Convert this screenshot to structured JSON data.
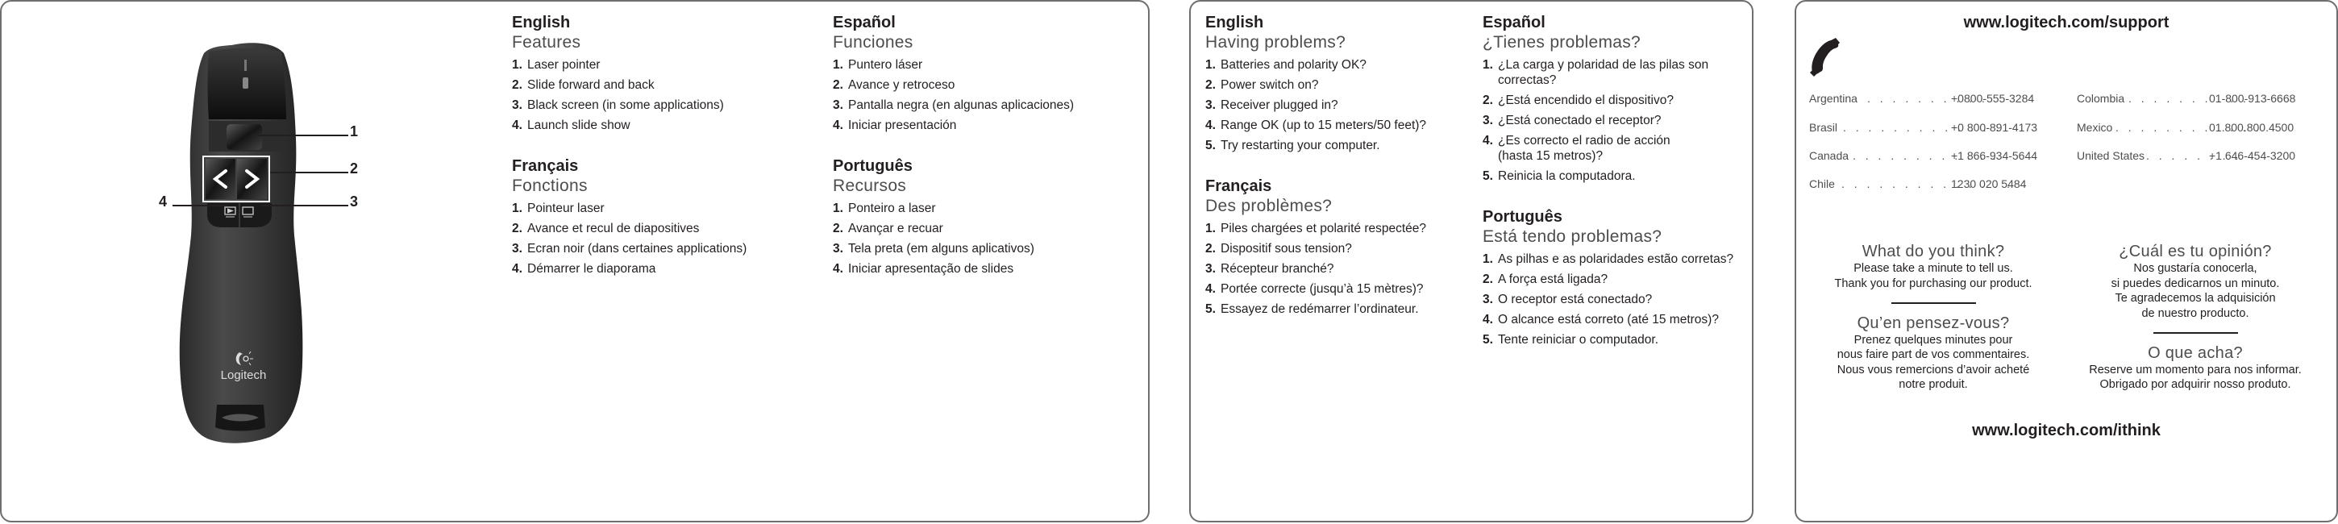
{
  "features_panel": {
    "device": {
      "brand_label": "Logitech",
      "callouts": [
        "1",
        "2",
        "3",
        "4"
      ]
    },
    "sections": [
      {
        "language": "English",
        "title": "Features",
        "items": [
          "Laser pointer",
          "Slide forward and back",
          "Black screen (in some applications)",
          "Launch slide show"
        ]
      },
      {
        "language": "Español",
        "title": "Funciones",
        "items": [
          "Puntero láser",
          "Avance y retroceso",
          "Pantalla negra (en algunas aplicaciones)",
          "Iniciar presentación"
        ]
      },
      {
        "language": "Français",
        "title": "Fonctions",
        "items": [
          "Pointeur laser",
          "Avance et recul de diapositives",
          "Ecran noir (dans certaines applications)",
          "Démarrer le diaporama"
        ]
      },
      {
        "language": "Português",
        "title": "Recursos",
        "items": [
          "Ponteiro a laser",
          "Avançar e recuar",
          "Tela preta (em alguns aplicativos)",
          "Iniciar apresentação de slides"
        ]
      }
    ]
  },
  "troubleshooting_panel": {
    "sections": [
      {
        "language": "English",
        "title": "Having problems?",
        "items": [
          "Batteries and polarity OK?",
          "Power switch on?",
          "Receiver plugged in?",
          "Range OK (up to 15 meters/50 feet)?",
          "Try restarting your computer."
        ]
      },
      {
        "language": "Español",
        "title": "¿Tienes problemas?",
        "items": [
          "¿La carga y polaridad de las pilas son correctas?",
          "¿Está encendido el dispositivo?",
          "¿Está conectado el receptor?",
          "¿Es correcto el radio de acción (hasta 15 metros)?",
          "Reinicia la computadora."
        ]
      },
      {
        "language": "Français",
        "title": "Des problèmes?",
        "items": [
          "Piles chargées et polarité respectée?",
          "Dispositif sous tension?",
          "Récepteur branché?",
          "Portée correcte (jusqu’à 15 mètres)?",
          "Essayez de redémarrer l’ordinateur."
        ]
      },
      {
        "language": "Português",
        "title": "Está tendo problemas?",
        "items": [
          "As pilhas e as polaridades estão corretas?",
          "A força está ligada?",
          "O receptor está conectado?",
          "O alcance está correto (até 15 metros)?",
          "Tente reiniciar o computador."
        ]
      }
    ]
  },
  "support_panel": {
    "support_url": "www.logitech.com/support",
    "phone_icon": "phone-handset-icon",
    "phones_left": [
      {
        "country": "Argentina",
        "number": "+0800-555-3284"
      },
      {
        "country": "Brasil",
        "number": "+0 800-891-4173"
      },
      {
        "country": "Canada",
        "number": "+1 866-934-5644"
      },
      {
        "country": "Chile",
        "number": "1230 020 5484"
      }
    ],
    "phones_right": [
      {
        "country": "Colombia",
        "number": "01-800-913-6668"
      },
      {
        "country": "Mexico",
        "number": "01.800.800.4500"
      },
      {
        "country": "United States",
        "number": "+1 646-454-3200"
      }
    ],
    "feedback_left": [
      {
        "title": "What do you think?",
        "body": [
          "Please take a minute to tell us.",
          "Thank you for purchasing our product."
        ]
      },
      {
        "title": "Qu’en pensez-vous?",
        "body": [
          "Prenez quelques minutes pour",
          "nous faire part de vos commentaires.",
          "Nous vous remercions d’avoir acheté",
          "notre produit."
        ]
      }
    ],
    "feedback_right": [
      {
        "title": "¿Cuál es tu opinión?",
        "body": [
          "Nos gustaría conocerla,",
          "si puedes dedicarnos un minuto.",
          "Te agradecemos la adquisición",
          "de nuestro producto."
        ]
      },
      {
        "title": "O que acha?",
        "body": [
          "Reserve um momento para nos informar.",
          "Obrigado por adquirir nosso produto."
        ]
      }
    ],
    "feedback_url": "www.logitech.com/ithink"
  }
}
